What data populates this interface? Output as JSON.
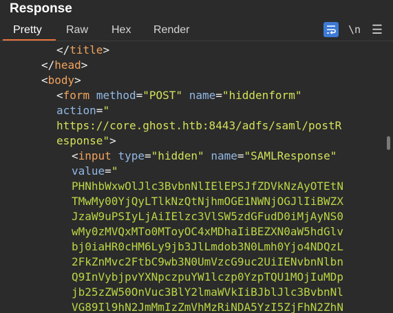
{
  "panel": {
    "title": "Response"
  },
  "tabs": [
    {
      "label": "Pretty",
      "active": true
    },
    {
      "label": "Raw",
      "active": false
    },
    {
      "label": "Hex",
      "active": false
    },
    {
      "label": "Render",
      "active": false
    }
  ],
  "toolbar": {
    "wrap_icon": "wrap-lines-icon",
    "newline_label": "\\n",
    "menu_icon": "hamburger-menu-icon",
    "accent_color": "#3d7ad6"
  },
  "code": {
    "close_title": {
      "open": "</",
      "name": "title",
      "close": ">"
    },
    "close_head": {
      "open": "</",
      "name": "head",
      "close": ">"
    },
    "open_body": {
      "open": "<",
      "name": "body",
      "close": ">"
    },
    "form": {
      "open": "<",
      "name": "form",
      "attr1": "method",
      "eq1": "=",
      "val1": "\"POST\"",
      "attr2": "name",
      "eq2": "=",
      "val2": "\"hiddenform\"",
      "attr3": "action",
      "eq3": "=",
      "val3_start": "\"",
      "url_line1": "https://core.ghost.htb:8443/adfs/saml/postR",
      "url_line2": "esponse\"",
      "close": ">"
    },
    "input": {
      "open": "<",
      "name": "input",
      "attr1": "type",
      "eq1": "=",
      "val1": "\"hidden\"",
      "attr2": "name",
      "eq2": "=",
      "val2": "\"SAMLResponse\"",
      "attr3": "value",
      "eq3": "=",
      "val3_start": "\""
    },
    "value_lines": [
      "PHNhbWxwOlJlc3BvbnNlIElEPSJfZDVkNzAyOTEtN",
      "TMwMy00YjQyLTlkNzQtNjhmOGE1NWNjOGJlIiBWZX",
      "JzaW9uPSIyLjAiIElzc3VlSW5zdGFudD0iMjAyNS0",
      "wMy0zMVQxMTo0MToyOC4xMDhaIiBEZXN0aW5hdGlv",
      "bj0iaHR0cHM6Ly9jb3JlLmdob3N0Lmh0Yjo4NDQzL",
      "2FkZnMvc2FtbC9wb3N0UmVzcG9uc2UiIENvbnNlbn",
      "Q9InVybjpvYXNpczpuYW1lczp0YzpTQU1MOjIuMDp",
      "jb25zZW50OnVuc3BlY2lmaWVkIiBJblJlc3BvbnNl",
      "VG89Il9hN2JmMmIzZmVhMzRiNDA5YzI5ZjFhN2ZhN"
    ]
  }
}
